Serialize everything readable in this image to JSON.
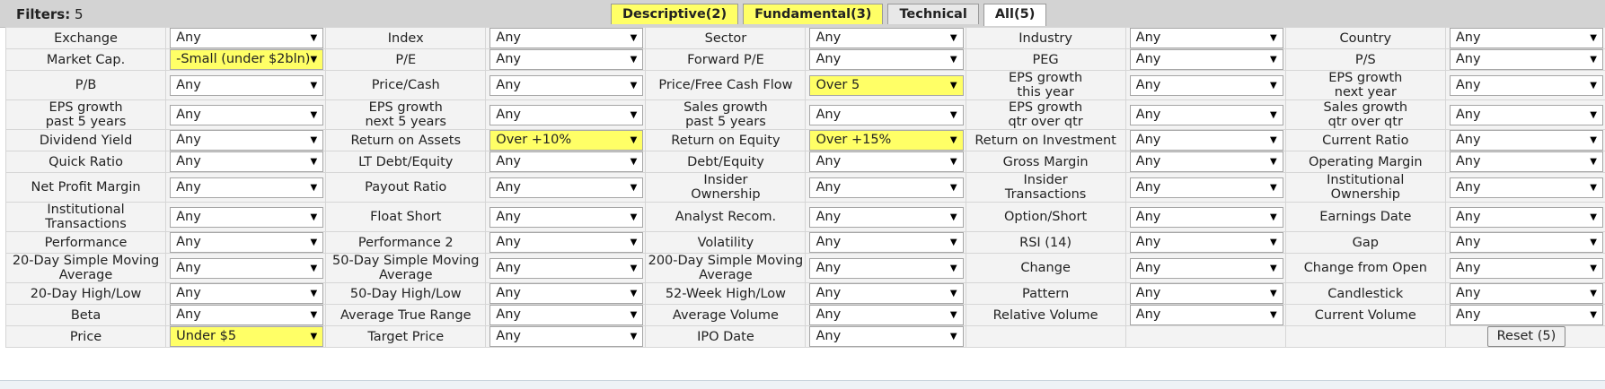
{
  "header": {
    "filters_label": "Filters:",
    "filters_count": "5",
    "tabs": [
      {
        "label": "Descriptive(2)"
      },
      {
        "label": "Fundamental(3)"
      },
      {
        "label": "Technical"
      },
      {
        "label": "All(5)"
      }
    ]
  },
  "colors": {
    "highlight": "#ffff66",
    "topbar": "#d3d3d3",
    "cell": "#f3f3f3"
  },
  "rows": [
    [
      {
        "label": "Exchange",
        "value": "Any"
      },
      {
        "label": "Index",
        "value": "Any"
      },
      {
        "label": "Sector",
        "value": "Any"
      },
      {
        "label": "Industry",
        "value": "Any"
      },
      {
        "label": "Country",
        "value": "Any"
      }
    ],
    [
      {
        "label": "Market Cap.",
        "value": "-Small (under $2bln)"
      },
      {
        "label": "P/E",
        "value": "Any"
      },
      {
        "label": "Forward P/E",
        "value": "Any"
      },
      {
        "label": "PEG",
        "value": "Any"
      },
      {
        "label": "P/S",
        "value": "Any"
      }
    ],
    [
      {
        "label": "P/B",
        "value": "Any"
      },
      {
        "label": "Price/Cash",
        "value": "Any"
      },
      {
        "label": "Price/Free Cash Flow",
        "value": "Over 5"
      },
      {
        "label": "EPS growth\nthis year",
        "value": "Any"
      },
      {
        "label": "EPS growth\nnext year",
        "value": "Any"
      }
    ],
    [
      {
        "label": "EPS growth\npast 5 years",
        "value": "Any"
      },
      {
        "label": "EPS growth\nnext 5 years",
        "value": "Any"
      },
      {
        "label": "Sales growth\npast 5 years",
        "value": "Any"
      },
      {
        "label": "EPS growth\nqtr over qtr",
        "value": "Any"
      },
      {
        "label": "Sales growth\nqtr over qtr",
        "value": "Any"
      }
    ],
    [
      {
        "label": "Dividend Yield",
        "value": "Any"
      },
      {
        "label": "Return on Assets",
        "value": "Over +10%"
      },
      {
        "label": "Return on Equity",
        "value": "Over +15%"
      },
      {
        "label": "Return on Investment",
        "value": "Any"
      },
      {
        "label": "Current Ratio",
        "value": "Any"
      }
    ],
    [
      {
        "label": "Quick Ratio",
        "value": "Any"
      },
      {
        "label": "LT Debt/Equity",
        "value": "Any"
      },
      {
        "label": "Debt/Equity",
        "value": "Any"
      },
      {
        "label": "Gross Margin",
        "value": "Any"
      },
      {
        "label": "Operating Margin",
        "value": "Any"
      }
    ],
    [
      {
        "label": "Net Profit Margin",
        "value": "Any"
      },
      {
        "label": "Payout Ratio",
        "value": "Any"
      },
      {
        "label": "Insider\nOwnership",
        "value": "Any"
      },
      {
        "label": "Insider\nTransactions",
        "value": "Any"
      },
      {
        "label": "Institutional\nOwnership",
        "value": "Any"
      }
    ],
    [
      {
        "label": "Institutional\nTransactions",
        "value": "Any"
      },
      {
        "label": "Float Short",
        "value": "Any"
      },
      {
        "label": "Analyst Recom.",
        "value": "Any"
      },
      {
        "label": "Option/Short",
        "value": "Any"
      },
      {
        "label": "Earnings Date",
        "value": "Any"
      }
    ],
    [
      {
        "label": "Performance",
        "value": "Any"
      },
      {
        "label": "Performance 2",
        "value": "Any"
      },
      {
        "label": "Volatility",
        "value": "Any"
      },
      {
        "label": "RSI (14)",
        "value": "Any"
      },
      {
        "label": "Gap",
        "value": "Any"
      }
    ],
    [
      {
        "label": "20-Day Simple Moving\nAverage",
        "value": "Any"
      },
      {
        "label": "50-Day Simple Moving\nAverage",
        "value": "Any"
      },
      {
        "label": "200-Day Simple Moving\nAverage",
        "value": "Any"
      },
      {
        "label": "Change",
        "value": "Any"
      },
      {
        "label": "Change from Open",
        "value": "Any"
      }
    ],
    [
      {
        "label": "20-Day High/Low",
        "value": "Any"
      },
      {
        "label": "50-Day High/Low",
        "value": "Any"
      },
      {
        "label": "52-Week High/Low",
        "value": "Any"
      },
      {
        "label": "Pattern",
        "value": "Any"
      },
      {
        "label": "Candlestick",
        "value": "Any"
      }
    ],
    [
      {
        "label": "Beta",
        "value": "Any"
      },
      {
        "label": "Average True Range",
        "value": "Any"
      },
      {
        "label": "Average Volume",
        "value": "Any"
      },
      {
        "label": "Relative Volume",
        "value": "Any"
      },
      {
        "label": "Current Volume",
        "value": "Any"
      }
    ],
    [
      {
        "label": "Price",
        "value": "Under $5"
      },
      {
        "label": "Target Price",
        "value": "Any"
      },
      {
        "label": "IPO Date",
        "value": "Any"
      }
    ]
  ],
  "reset_label": "Reset (5)",
  "dropdown_icon": "triangle-down"
}
